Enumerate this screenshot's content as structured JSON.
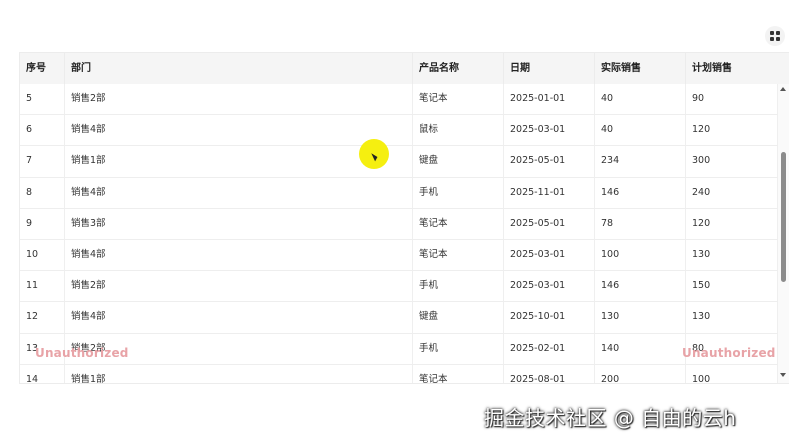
{
  "toolbar": {
    "layout_icon": "grid-layout-icon"
  },
  "table": {
    "columns": [
      "序号",
      "部门",
      "产品名称",
      "日期",
      "实际销售",
      "计划销售"
    ],
    "rows": [
      [
        "5",
        "销售2部",
        "笔记本",
        "2025-01-01",
        "40",
        "90"
      ],
      [
        "6",
        "销售4部",
        "鼠标",
        "2025-03-01",
        "40",
        "120"
      ],
      [
        "7",
        "销售1部",
        "键盘",
        "2025-05-01",
        "234",
        "300"
      ],
      [
        "8",
        "销售4部",
        "手机",
        "2025-11-01",
        "146",
        "240"
      ],
      [
        "9",
        "销售3部",
        "笔记本",
        "2025-05-01",
        "78",
        "120"
      ],
      [
        "10",
        "销售4部",
        "笔记本",
        "2025-03-01",
        "100",
        "130"
      ],
      [
        "11",
        "销售2部",
        "手机",
        "2025-03-01",
        "146",
        "150"
      ],
      [
        "12",
        "销售4部",
        "键盘",
        "2025-10-01",
        "130",
        "130"
      ],
      [
        "13",
        "销售2部",
        "手机",
        "2025-02-01",
        "140",
        "80"
      ],
      [
        "14",
        "销售1部",
        "笔记本",
        "2025-08-01",
        "200",
        "100"
      ]
    ]
  },
  "watermark": {
    "left": "Unauthorized",
    "right": "Unauthorized"
  },
  "footer": {
    "brand": "掘金技术社区 @ 自由的云h"
  },
  "colors": {
    "watermark": "#e8a3a7",
    "cursor_highlight": "#f5ef10",
    "header_bg": "#f5f5f5"
  }
}
